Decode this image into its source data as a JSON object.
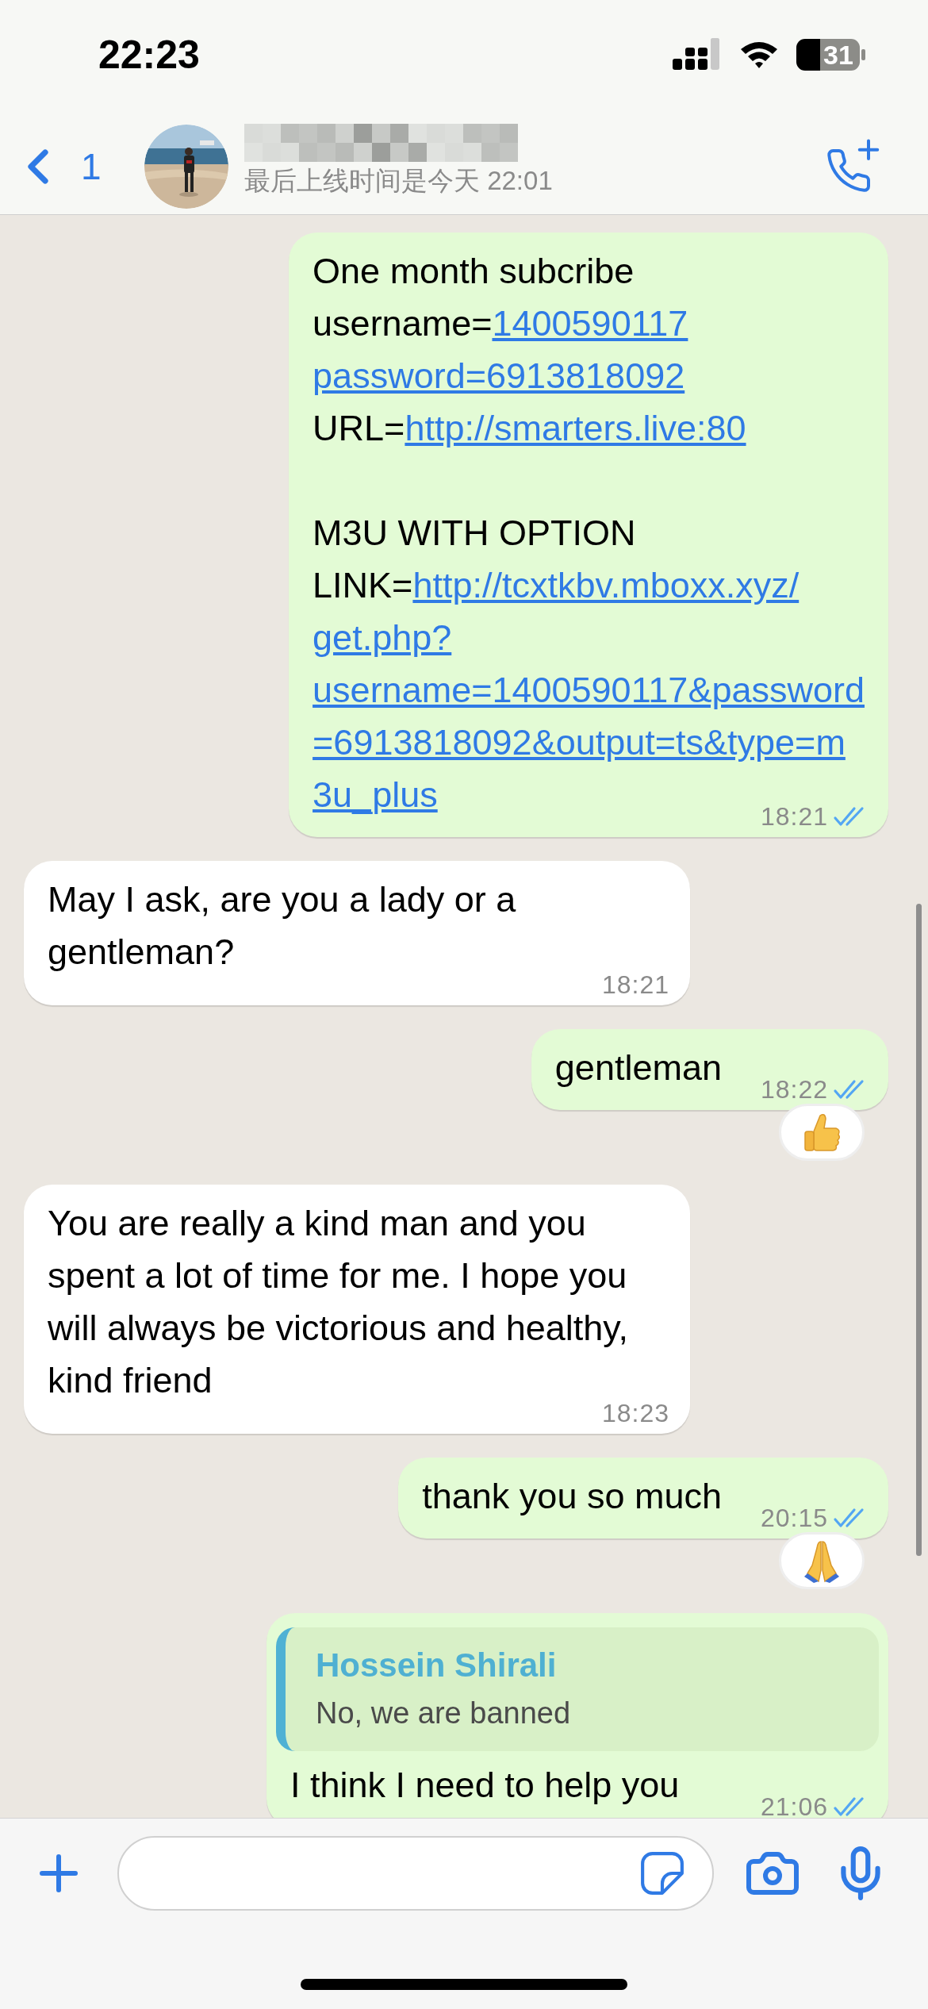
{
  "status_bar": {
    "time": "22:23",
    "battery": "31"
  },
  "header": {
    "unread_count": "1",
    "last_seen": "最后上线时间是今天 22:01"
  },
  "messages": [
    {
      "outgoing": true,
      "time": "18:21",
      "read": true,
      "lines": [
        {
          "kind": "text",
          "segments": [
            {
              "text": "One month subcribe",
              "link": false
            }
          ]
        },
        {
          "kind": "text",
          "segments": [
            {
              "text": "username=",
              "link": false
            },
            {
              "text": "1400590117",
              "link": true
            }
          ]
        },
        {
          "kind": "text",
          "segments": [
            {
              "text": "password=6913818092",
              "link": true
            }
          ]
        },
        {
          "kind": "text",
          "segments": [
            {
              "text": "URL=",
              "link": false
            },
            {
              "text": "http://smarters.live:80",
              "link": true
            }
          ]
        },
        {
          "kind": "blank"
        },
        {
          "kind": "text",
          "segments": [
            {
              "text": "M3U WITH OPTION",
              "link": false
            }
          ]
        },
        {
          "kind": "text",
          "segments": [
            {
              "text": "LINK=",
              "link": false
            },
            {
              "text": "http://tcxtkbv.mboxx.xyz/",
              "link": true
            }
          ]
        },
        {
          "kind": "text",
          "segments": [
            {
              "text": "get.php?",
              "link": true
            }
          ]
        },
        {
          "kind": "text",
          "segments": [
            {
              "text": "username=1400590117&password",
              "link": true
            }
          ]
        },
        {
          "kind": "text",
          "segments": [
            {
              "text": "=6913818092&output=ts&type=m",
              "link": true
            }
          ]
        },
        {
          "kind": "text",
          "segments": [
            {
              "text": "3u_plus",
              "link": true
            }
          ]
        }
      ]
    },
    {
      "outgoing": false,
      "time": "18:21",
      "text": "May I ask, are you a lady or a gentleman?"
    },
    {
      "outgoing": true,
      "time": "18:22",
      "read": true,
      "text": "gentleman",
      "reaction": {
        "kind": "thumbs_up"
      }
    },
    {
      "outgoing": false,
      "time": "18:23",
      "text": "You are really a kind man and you spent a lot of time for me. I hope you will always be victorious and healthy, kind friend"
    },
    {
      "outgoing": true,
      "time": "20:15",
      "read": true,
      "text": "thank you so much",
      "reaction": {
        "kind": "pray"
      }
    },
    {
      "outgoing": true,
      "time": "21:06",
      "read": true,
      "text": "I think I need to help you",
      "quote": {
        "author": "Hossein Shirali",
        "text": "No, we are banned"
      }
    }
  ]
}
